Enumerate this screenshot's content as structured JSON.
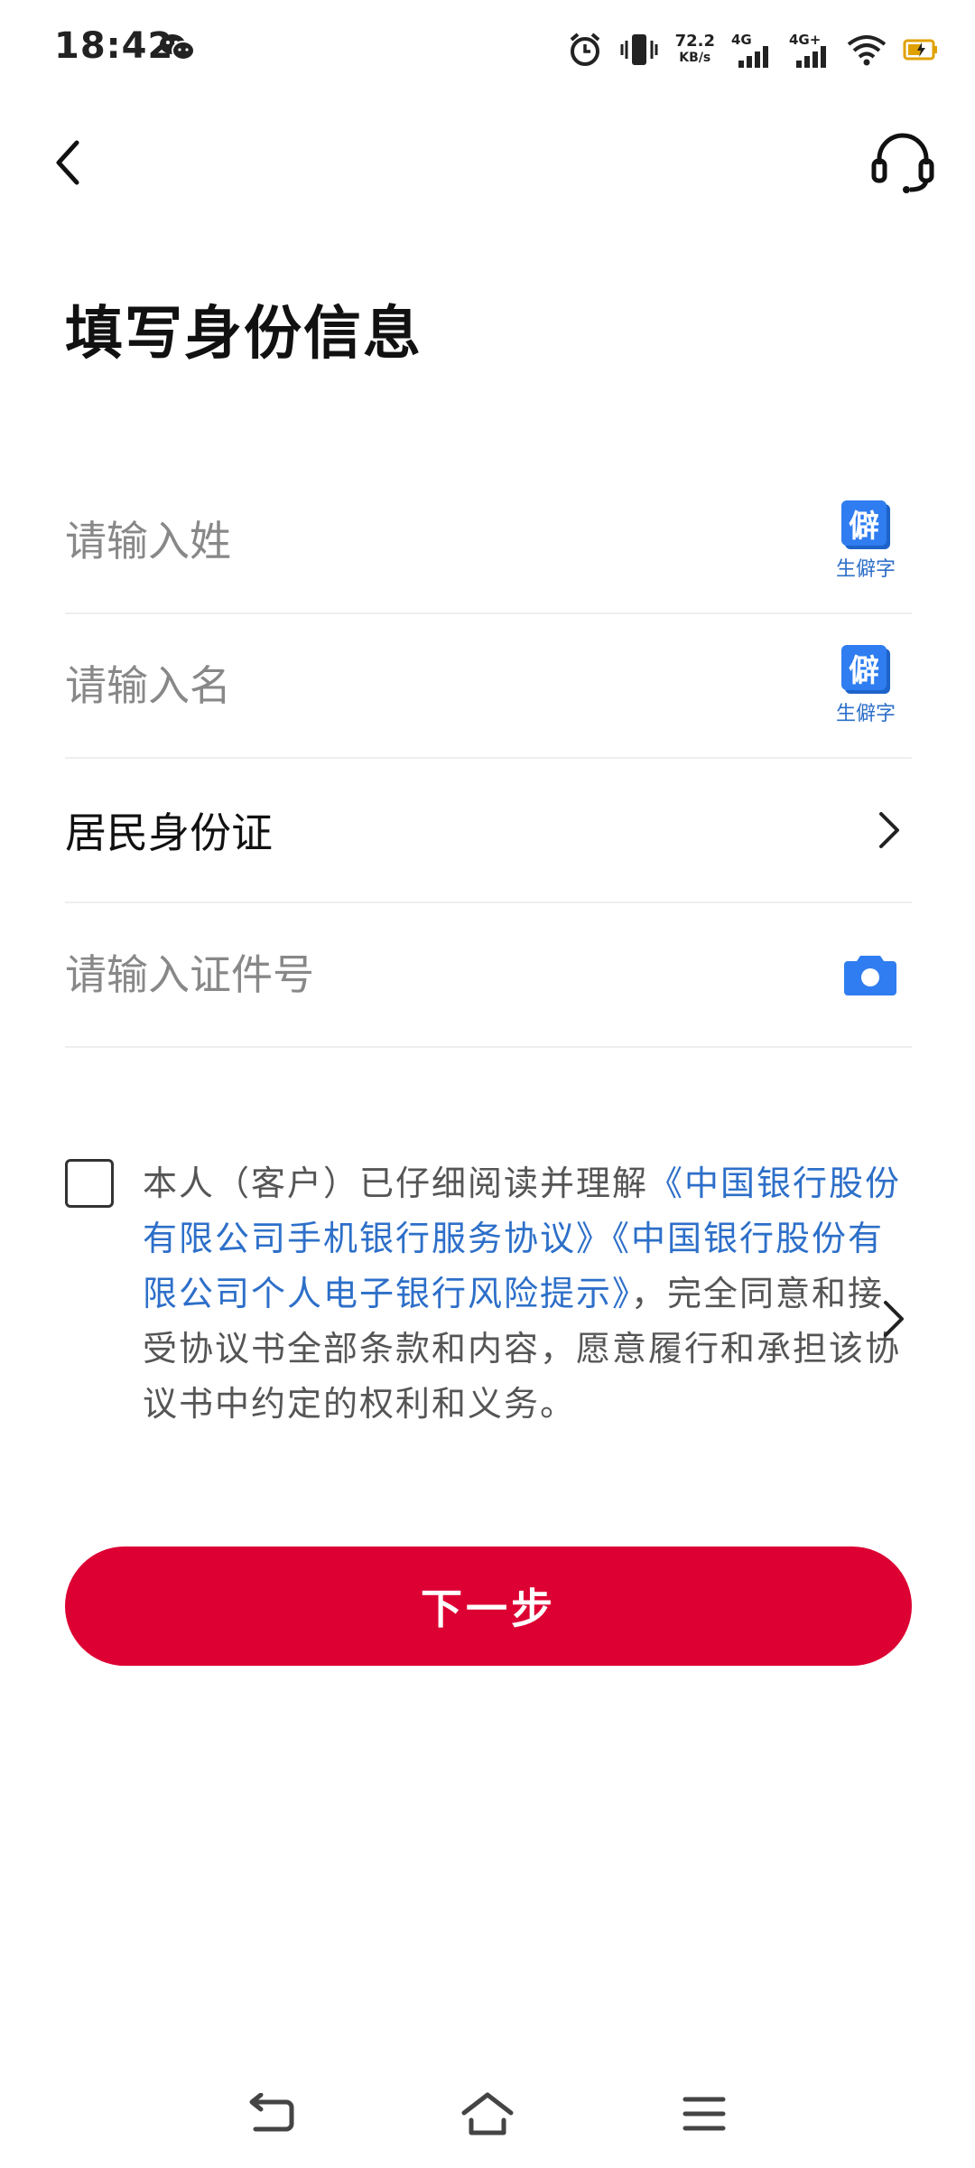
{
  "status_bar": {
    "time": "18:42",
    "speed_value": "72.2",
    "speed_unit": "KB/s",
    "net1": "4G",
    "net2": "4G+",
    "icons": [
      "wechat-icon",
      "alarm-icon",
      "vibrate-icon",
      "signal-icon",
      "wifi-icon",
      "battery-icon"
    ]
  },
  "header": {
    "back_icon": "chevron-left-icon",
    "support_icon": "headset-icon"
  },
  "page": {
    "title": "填写身份信息"
  },
  "form": {
    "surname_placeholder": "请输入姓",
    "given_name_placeholder": "请输入名",
    "rare_char_badge": "僻",
    "rare_char_label": "生僻字",
    "id_type_value": "居民身份证",
    "id_number_placeholder": "请输入证件号",
    "accent_color": "#2f7df0"
  },
  "agreement": {
    "text_before": "本人（客户）已仔细阅读并理解",
    "link1": "《中国银行股份有限公司手机银行服务协议》",
    "link2": "《中国银行股份有限公司个人电子银行风险提示》",
    "text_after": "，完全同意和接受协议书全部条款和内容，愿意履行和承担该协议书中约定的权利和义务。",
    "link_color": "#2d6fc9"
  },
  "actions": {
    "next_label": "下一步",
    "button_color": "#dd0033"
  },
  "nav_bar": {
    "icons": [
      "back-nav-icon",
      "home-icon",
      "menu-icon"
    ]
  }
}
